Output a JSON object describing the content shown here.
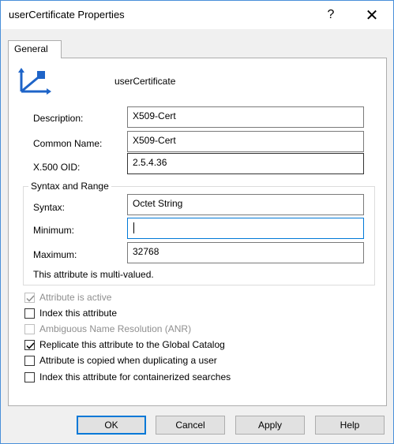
{
  "window": {
    "title": "userCertificate Properties",
    "help_glyph": "?",
    "close_glyph": "✕"
  },
  "tabs": [
    {
      "label": "General"
    }
  ],
  "attribute": {
    "name": "userCertificate",
    "icon": "attribute-icon"
  },
  "fields": {
    "description": {
      "label": "Description:",
      "value": "X509-Cert"
    },
    "common_name": {
      "label": "Common Name:",
      "value": "X509-Cert"
    },
    "oid": {
      "label": "X.500 OID:",
      "value": "2.5.4.36"
    }
  },
  "syntax_group": {
    "title": "Syntax and Range",
    "syntax": {
      "label": "Syntax:",
      "value": "Octet String"
    },
    "minimum": {
      "label": "Minimum:",
      "value": ""
    },
    "maximum": {
      "label": "Maximum:",
      "value": "32768"
    },
    "multi_valued_text": "This attribute is multi-valued."
  },
  "checkboxes": [
    {
      "label": "Attribute is active",
      "checked": true,
      "disabled": true
    },
    {
      "label": "Index this attribute",
      "checked": false,
      "disabled": false
    },
    {
      "label": "Ambiguous Name Resolution (ANR)",
      "checked": false,
      "disabled": true
    },
    {
      "label": "Replicate this attribute to the Global Catalog",
      "checked": true,
      "disabled": false
    },
    {
      "label": "Attribute is copied when duplicating a user",
      "checked": false,
      "disabled": false
    },
    {
      "label": "Index this attribute for containerized searches",
      "checked": false,
      "disabled": false
    }
  ],
  "buttons": {
    "ok": "OK",
    "cancel": "Cancel",
    "apply": "Apply",
    "help": "Help"
  },
  "colors": {
    "accent": "#0078d7",
    "icon_blue": "#1e64c8",
    "disabled_text": "#8f8f8f"
  }
}
